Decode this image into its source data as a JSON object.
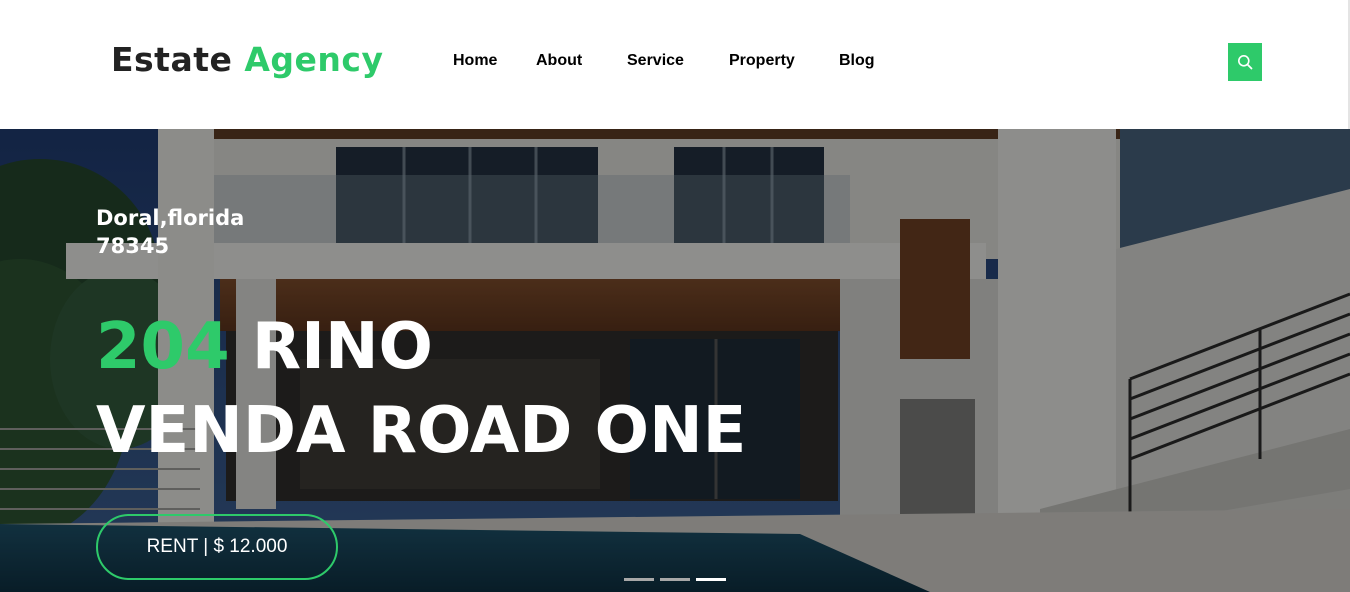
{
  "brand": {
    "name_part1": "Estate",
    "name_part2": "Agency"
  },
  "nav": {
    "items": [
      {
        "label": "Home"
      },
      {
        "label": "About"
      },
      {
        "label": "Service"
      },
      {
        "label": "Property"
      },
      {
        "label": "Blog"
      }
    ]
  },
  "search": {
    "icon": "search-icon"
  },
  "hero": {
    "location_line1": "Doral,florida",
    "location_line2": "78345",
    "title_number": "204",
    "title_rest_line1": "RINO",
    "title_line2": "VENDA ROAD ONE",
    "cta_label": "RENT | $ 12.000"
  },
  "carousel": {
    "slide_count": 3,
    "active_index": 2
  },
  "colors": {
    "accent": "#2eca6a",
    "text_dark": "#222222",
    "nav_text": "#000000"
  }
}
